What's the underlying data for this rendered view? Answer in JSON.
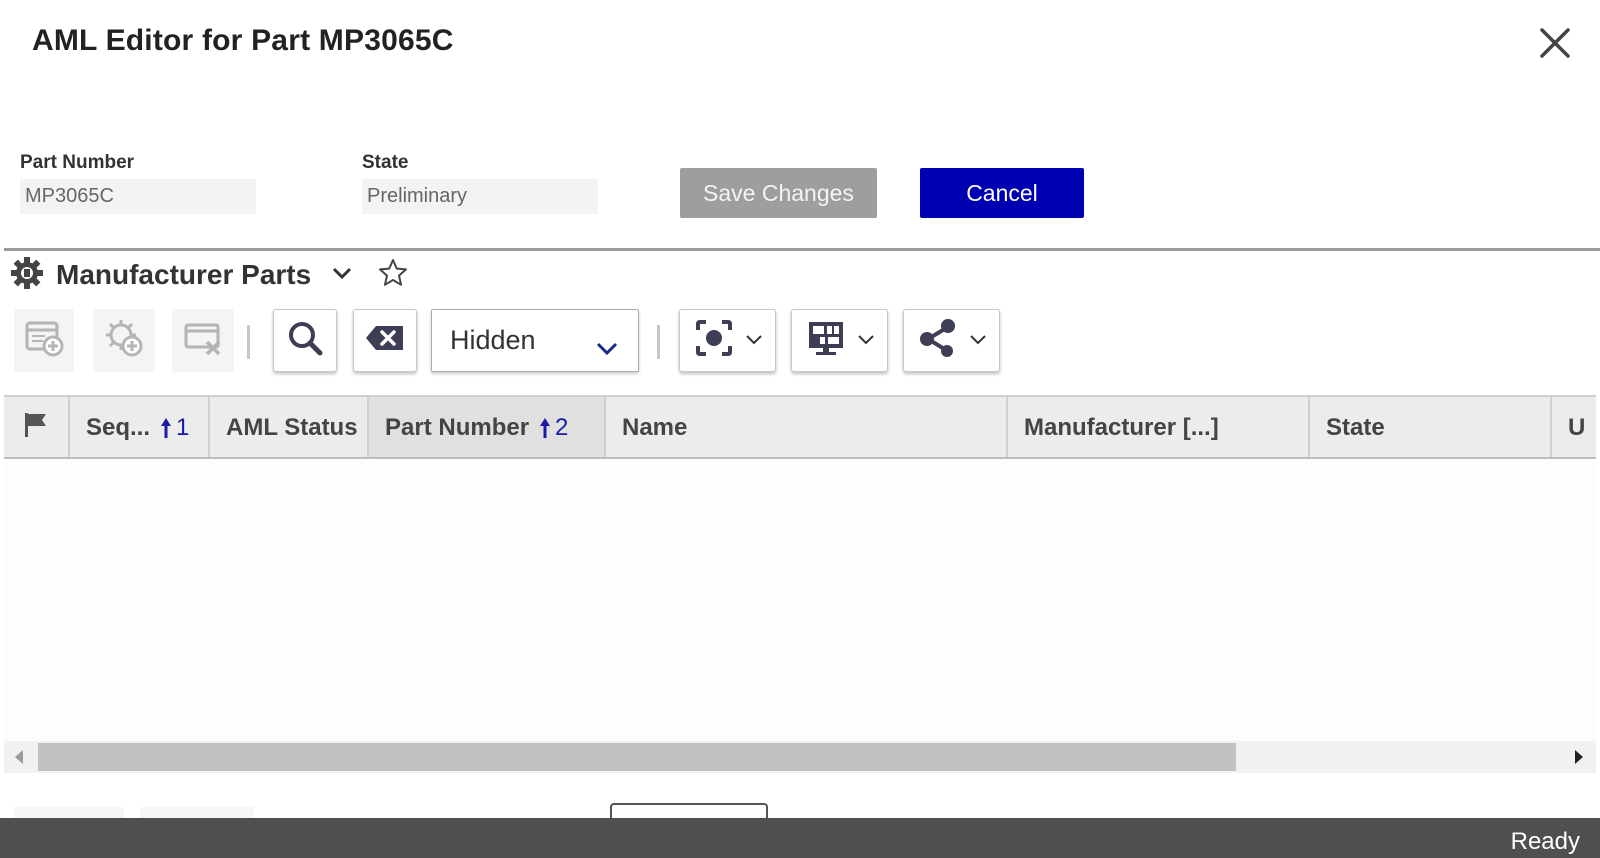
{
  "dialog": {
    "title": "AML Editor for Part MP3065C"
  },
  "form": {
    "part_number_label": "Part Number",
    "part_number_value": "MP3065C",
    "state_label": "State",
    "state_value": "Preliminary",
    "save_label": "Save Changes",
    "cancel_label": "Cancel"
  },
  "panel": {
    "title": "Manufacturer Parts",
    "icons": {
      "title_icon": "gear-icon",
      "collapse": "chevron-down-icon",
      "favorite": "star-icon"
    }
  },
  "toolbar": {
    "buttons": [
      {
        "name": "add-row",
        "icon": "table-add-icon",
        "enabled": false
      },
      {
        "name": "add-part",
        "icon": "gear-add-icon",
        "enabled": false
      },
      {
        "name": "remove-row",
        "icon": "table-remove-icon",
        "enabled": false
      },
      {
        "name": "search",
        "icon": "search-icon",
        "enabled": true
      },
      {
        "name": "clear",
        "icon": "backspace-icon",
        "enabled": true
      },
      {
        "name": "focus",
        "icon": "focus-icon",
        "enabled": true
      },
      {
        "name": "layout",
        "icon": "layout-icon",
        "enabled": true
      },
      {
        "name": "share",
        "icon": "share-icon",
        "enabled": true
      }
    ],
    "filter_select": "Hidden"
  },
  "grid": {
    "columns": [
      {
        "label": "",
        "icon": "flag-icon"
      },
      {
        "label": "Seq...",
        "sort": "1"
      },
      {
        "label": "AML Status"
      },
      {
        "label": "Part Number",
        "sort": "2"
      },
      {
        "label": "Name"
      },
      {
        "label": "Manufacturer [...]"
      },
      {
        "label": "State"
      },
      {
        "label": "U"
      }
    ],
    "rows": []
  },
  "status": {
    "text": "Ready"
  },
  "colors": {
    "primary": "#0000b3",
    "disabled_button": "#9e9e9e",
    "status_bar": "#4f4f4f",
    "sort_indicator": "#1a1aa6"
  }
}
